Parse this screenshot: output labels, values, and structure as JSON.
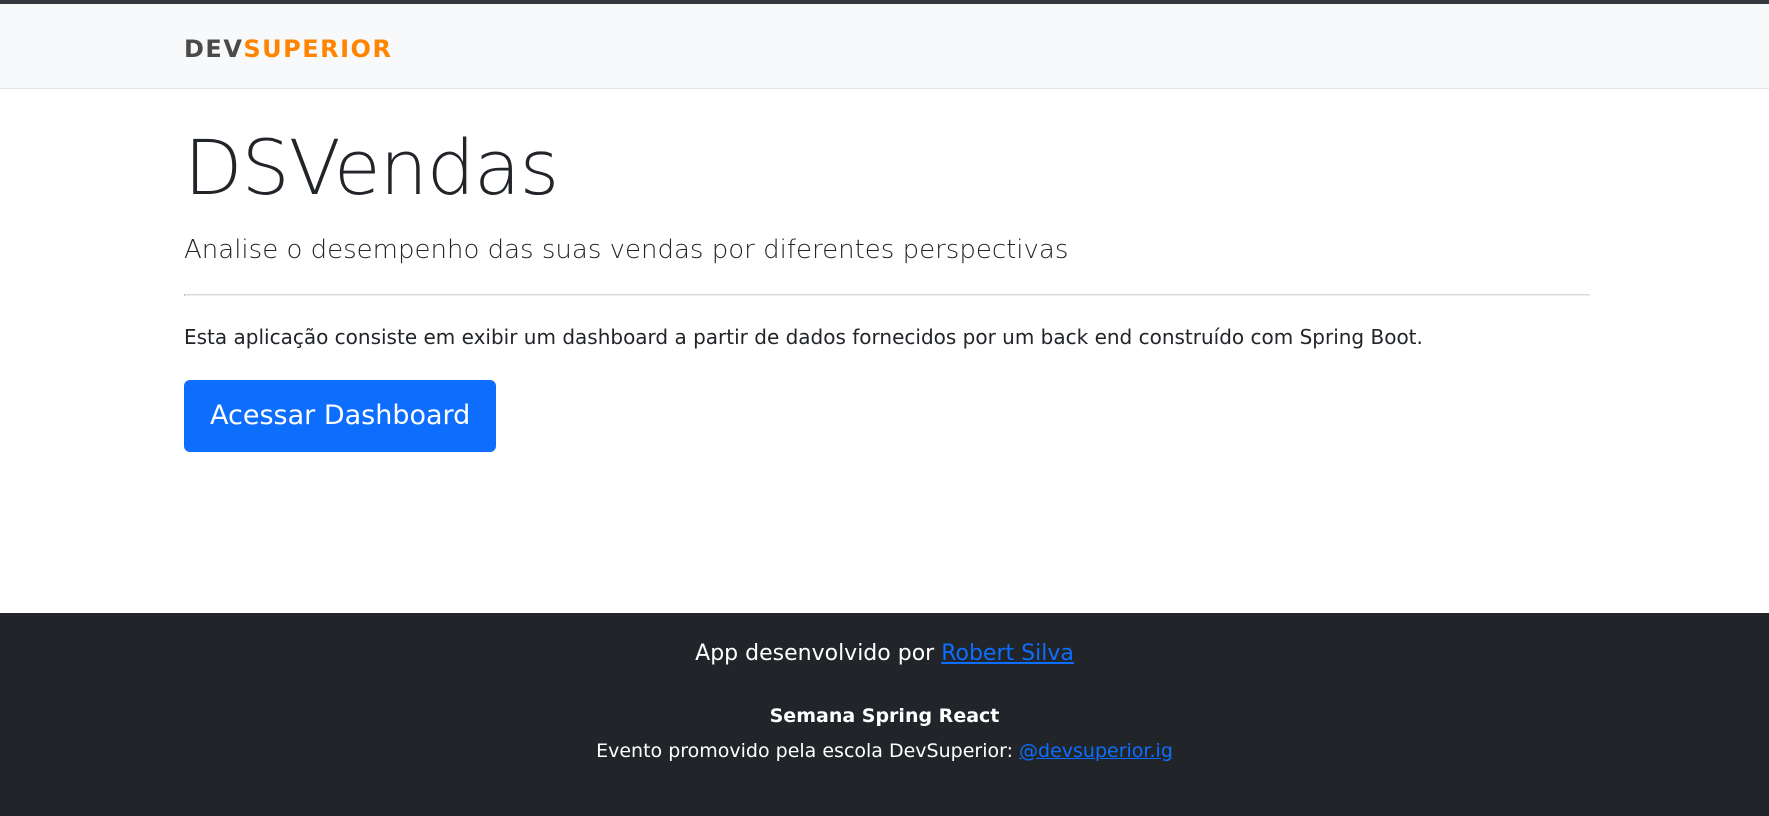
{
  "navbar": {
    "logo_part1": "DEV",
    "logo_part2": "SUPERIOR",
    "logo_colors": {
      "dev": "#4a4a4a",
      "superior": "#ff8400"
    }
  },
  "main": {
    "title": "DSVendas",
    "lead": "Analise o desempenho das suas vendas por diferentes perspectivas",
    "description": "Esta aplicação consiste em exibir um dashboard a partir de dados fornecidos por um back end construído com Spring Boot.",
    "button_label": "Acessar Dashboard"
  },
  "footer": {
    "dev_prefix": "App desenvolvido por ",
    "dev_link": "Robert Silva",
    "event_title": "Semana Spring React",
    "event_prefix": "Evento promovido pela escola DevSuperior: ",
    "event_link": "@devsuperior.ig"
  },
  "colors": {
    "primary": "#0d6efd",
    "navbar_bg": "#f8f9fa",
    "footer_bg": "#212529",
    "text": "#212529"
  }
}
